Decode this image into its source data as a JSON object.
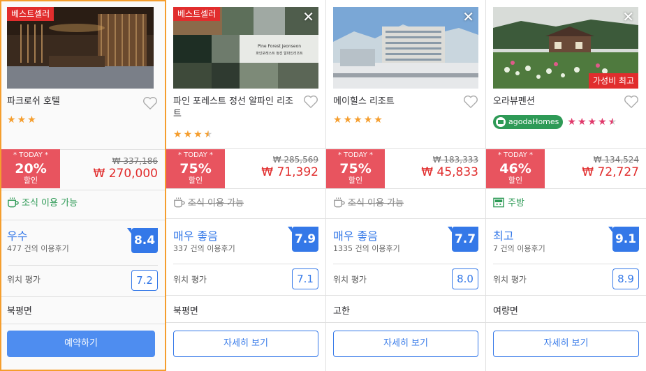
{
  "cards": [
    {
      "badge": "베스트셀러",
      "name": "파크로쉬 호텔",
      "stars": 3,
      "today": "* TODAY *",
      "discount": "20%",
      "discount_label": "할인",
      "original_price": "₩ 337,186",
      "price": "₩ 270,000",
      "amenity": "조식 이용 가능",
      "amenity_available": true,
      "score_label": "우수",
      "reviews": "477 건의 이용후기",
      "score": "8.4",
      "location_label": "위치 평가",
      "location_score": "7.2",
      "area": "북평면",
      "button": "예약하기"
    },
    {
      "badge": "베스트셀러",
      "name": "파인 포레스트 정선 알파인 리조트",
      "stars": 3.5,
      "today": "* TODAY *",
      "discount": "75%",
      "discount_label": "할인",
      "original_price": "₩ 285,569",
      "price": "₩ 71,392",
      "amenity": "조식 이용 가능",
      "amenity_available": false,
      "score_label": "매우 좋음",
      "reviews": "337 건의 이용후기",
      "score": "7.9",
      "location_label": "위치 평가",
      "location_score": "7.1",
      "area": "북평면",
      "button": "자세히 보기",
      "photo_caption_line1": "Pine Forest Jeonseon",
      "photo_caption_line2": "파인포레스트 정선 알파인리조트"
    },
    {
      "name": "메이힐스 리조트",
      "stars": 5,
      "today": "* TODAY *",
      "discount": "75%",
      "discount_label": "할인",
      "original_price": "₩ 183,333",
      "price": "₩ 45,833",
      "amenity": "조식 이용 가능",
      "amenity_available": false,
      "score_label": "매우 좋음",
      "reviews": "1335 건의 이용후기",
      "score": "7.7",
      "location_label": "위치 평가",
      "location_score": "8.0",
      "area": "고한",
      "button": "자세히 보기"
    },
    {
      "name": "오라뷰펜션",
      "value_badge": "가성비 최고",
      "agoda_badge": "agodaHomes",
      "stars": 4.5,
      "today": "* TODAY *",
      "discount": "46%",
      "discount_label": "할인",
      "original_price": "₩ 134,524",
      "price": "₩ 72,727",
      "amenity": "주방",
      "amenity_available": true,
      "score_label": "최고",
      "reviews": "7 건의 이용후기",
      "score": "9.1",
      "location_label": "위치 평가",
      "location_score": "8.9",
      "area": "여량면",
      "button": "자세히 보기"
    }
  ],
  "colors": {
    "accent_blue": "#3478e8",
    "sale_red": "#e8545f",
    "price_red": "#e12d2d",
    "selected_border": "#f59e2e",
    "star_orange": "#f59e2e",
    "star_pink": "#e0386a",
    "amenity_green": "#2e9a56"
  }
}
